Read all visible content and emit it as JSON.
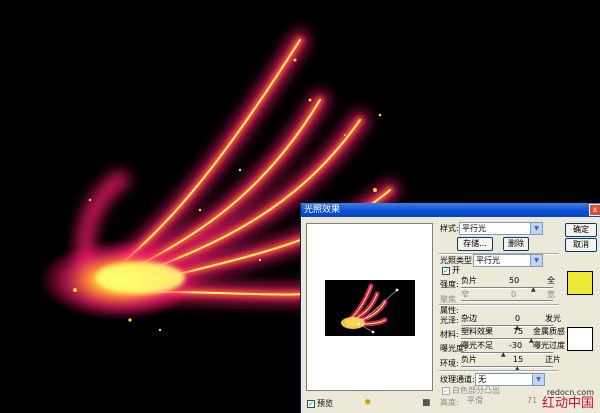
{
  "dialog": {
    "title": "光照效果",
    "close": "x",
    "style_label": "样式:",
    "style_value": "平行光",
    "save_button": "存储...",
    "delete_button": "删除",
    "ok_button": "确定",
    "cancel_button": "取消",
    "light_type_label": "光照类型:",
    "light_type_value": "平行光",
    "on_label": "开",
    "intensity": {
      "label": "强度:",
      "left": "负片",
      "value": "50",
      "right": "全"
    },
    "focus": {
      "label": "聚焦",
      "left": "窄",
      "value": "0",
      "right": "宽"
    },
    "properties_label": "属性:",
    "gloss": {
      "label": "光泽:",
      "left": "杂边",
      "value": "0",
      "right": "发光"
    },
    "material": {
      "label": "材料:",
      "left": "塑料效果",
      "value": "75",
      "right": "金属质感"
    },
    "exposure": {
      "label": "曝光度:",
      "left": "曝光不足",
      "value": "-30",
      "right": "曝光过度"
    },
    "ambience": {
      "label": "环境:",
      "left": "负片",
      "value": "15",
      "right": "正片"
    },
    "texture_label": "纹理通道:",
    "texture_value": "无",
    "white_high_label": "白色部分凸出",
    "height": {
      "label": "高度:",
      "left": "平滑",
      "value": "71"
    },
    "preview_label": "预览",
    "light_color": "#f0e836",
    "property_color": "#ffffff"
  },
  "watermark": {
    "url": "redocn.com",
    "cn": "红动中国"
  }
}
